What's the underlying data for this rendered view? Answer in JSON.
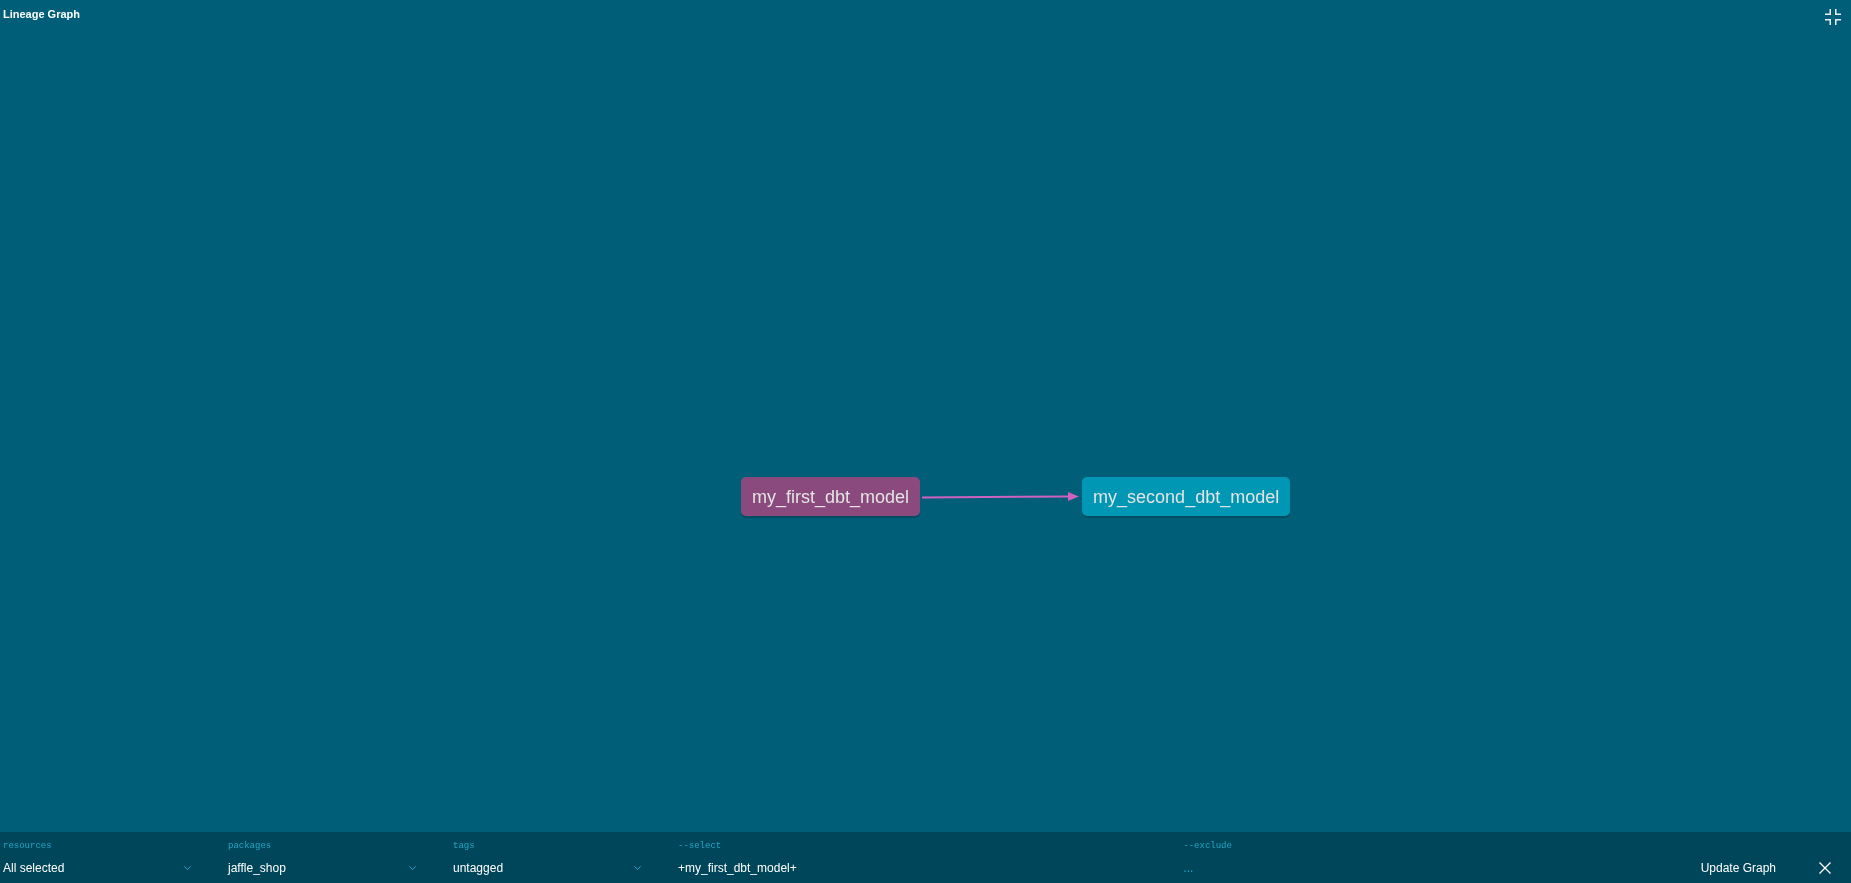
{
  "window": {
    "title": "Lineage Graph"
  },
  "graph": {
    "nodes": [
      {
        "label": "my_first_dbt_model",
        "color": "#8b4a7d",
        "children": [
          {
            "label": "my_second_dbt_model",
            "color": "#0097b5"
          }
        ]
      }
    ]
  },
  "filters": [
    {
      "kind": "dropdown",
      "label": "resources",
      "value": "All selected"
    },
    {
      "kind": "dropdown",
      "label": "packages",
      "value": "jaffle_shop"
    },
    {
      "kind": "dropdown",
      "label": "tags",
      "value": "untagged"
    },
    {
      "kind": "text",
      "label": "--select",
      "value": "+my_first_dbt_model+"
    },
    {
      "kind": "text",
      "label": "--exclude",
      "placeholder": "..."
    }
  ],
  "actions": {
    "update_button": "Update Graph"
  }
}
